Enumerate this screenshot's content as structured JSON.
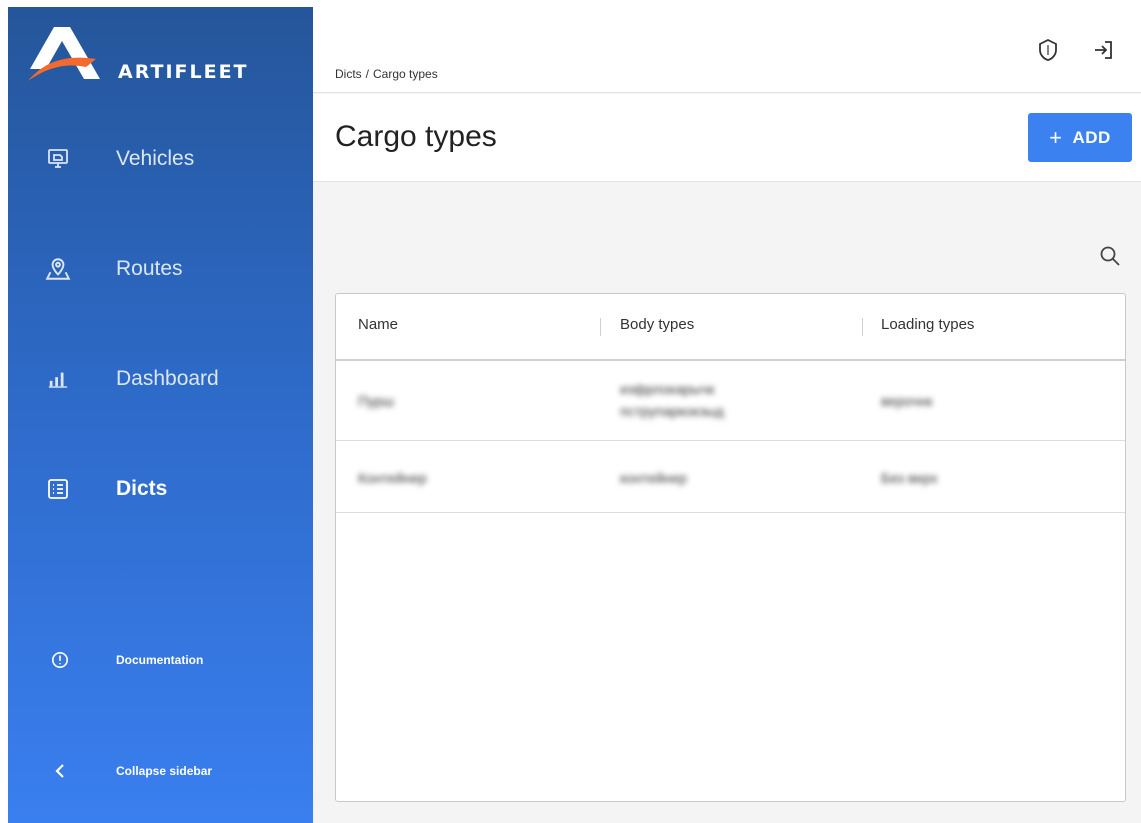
{
  "app": {
    "brand": "ARTIFLEET",
    "colors": {
      "sidebar_top": "#25569a",
      "sidebar_bottom": "#3a7ff0",
      "accent": "#3b82f0",
      "logo_orange": "#f26a2e"
    }
  },
  "sidebar": {
    "items": [
      {
        "label": "Vehicles",
        "icon": "monitor-icon"
      },
      {
        "label": "Routes",
        "icon": "map-pin-icon"
      },
      {
        "label": "Dashboard",
        "icon": "bar-chart-icon"
      },
      {
        "label": "Dicts",
        "icon": "list-icon",
        "active": true
      }
    ],
    "documentation_label": "Documentation",
    "collapse_label": "Collapse sidebar"
  },
  "header": {
    "breadcrumb": [
      "Dicts",
      "Cargo types"
    ],
    "breadcrumb_separator": "/",
    "icons": [
      "shield-icon",
      "logout-icon"
    ]
  },
  "page": {
    "title": "Cargo types",
    "add_label": "ADD",
    "add_icon": "+"
  },
  "table": {
    "columns": [
      "Name",
      "Body types",
      "Loading types"
    ],
    "rows": [
      {
        "name": "Пурш",
        "body_types": "изфрлокарычк пструпаркокзыд",
        "loading_types": "верочнк"
      },
      {
        "name": "Контейнер",
        "body_types": "контейнер",
        "loading_types": "Без верх"
      }
    ]
  }
}
